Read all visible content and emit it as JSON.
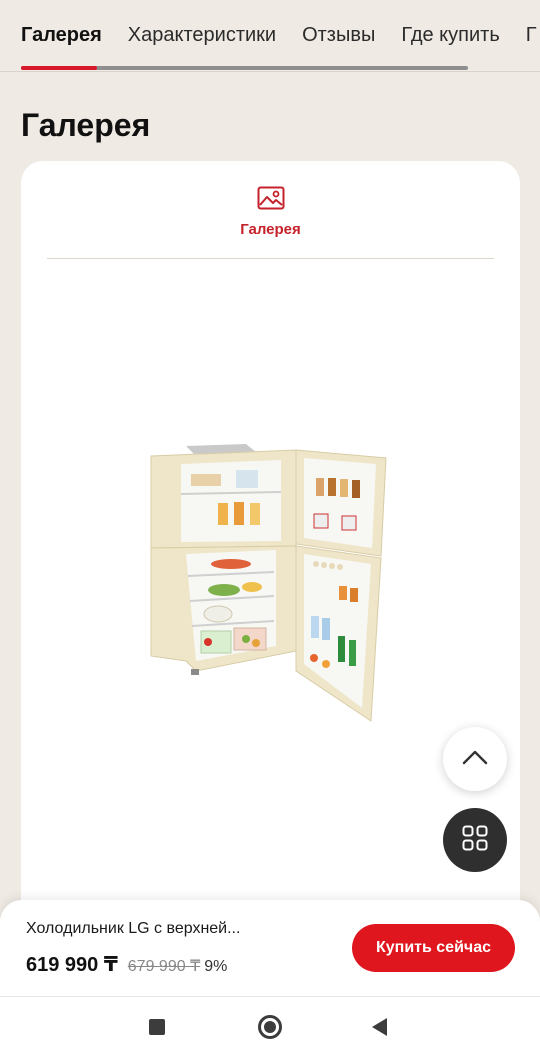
{
  "tabs": [
    {
      "label": "Галерея",
      "active": true
    },
    {
      "label": "Характеристики",
      "active": false
    },
    {
      "label": "Отзывы",
      "active": false
    },
    {
      "label": "Где купить",
      "active": false
    },
    {
      "label": "Г",
      "active": false
    }
  ],
  "section": {
    "title": "Галерея"
  },
  "gallery": {
    "tab_label": "Галерея",
    "tab_icon": "image-icon",
    "image": "fridge-top-freezer-open-beige"
  },
  "floating": {
    "scroll_top_icon": "chevron-up-icon",
    "menu_icon": "grid-icon"
  },
  "purchase": {
    "product_name": "Холодильник LG с верхней...",
    "price": "619 990 ₸",
    "old_price": "679 990 ₸",
    "discount": "9%",
    "buy_label": "Купить сейчас"
  },
  "navbar": {
    "recent_icon": "square-icon",
    "home_icon": "circle-icon",
    "back_icon": "triangle-back-icon"
  },
  "colors": {
    "accent": "#e0161f",
    "tab_indicator": "#d7192b",
    "background": "#efeae3"
  }
}
